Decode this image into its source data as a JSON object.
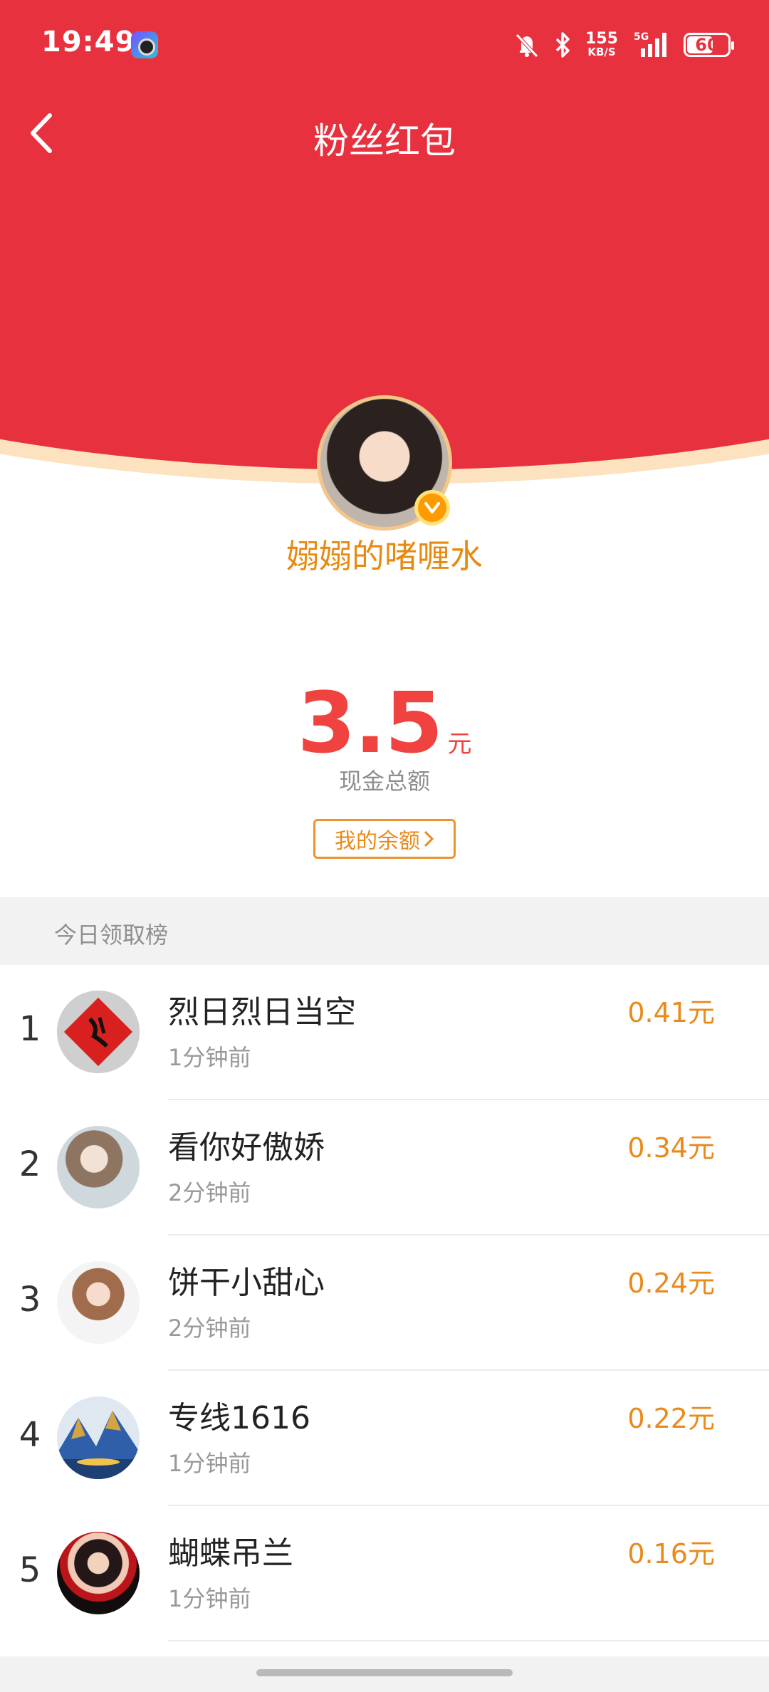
{
  "status_bar": {
    "time": "19:49",
    "net_speed": "155",
    "net_unit": "KB/S",
    "network": "5G",
    "battery": "60"
  },
  "header": {
    "title": "粉丝红包"
  },
  "profile": {
    "username": "嫋嫋的啫喱水",
    "badge": "V"
  },
  "cash": {
    "amount": "3.5",
    "unit": "元",
    "label": "现金总额",
    "balance_button": "我的余额"
  },
  "leaderboard": {
    "title": "今日领取榜",
    "entries": [
      {
        "rank": "1",
        "name": "烈日烈日当空",
        "time": "1分钟前",
        "amount": "0.41元"
      },
      {
        "rank": "2",
        "name": "看你好傲娇",
        "time": "2分钟前",
        "amount": "0.34元"
      },
      {
        "rank": "3",
        "name": "饼干小甜心",
        "time": "2分钟前",
        "amount": "0.24元"
      },
      {
        "rank": "4",
        "name": "专线1616",
        "time": "1分钟前",
        "amount": "0.22元"
      },
      {
        "rank": "5",
        "name": "蝴蝶吊兰",
        "time": "1分钟前",
        "amount": "0.16元"
      }
    ]
  },
  "colors": {
    "primary_red": "#e8313f",
    "gold": "#ea8a1b",
    "amount_red": "#f0423e"
  }
}
